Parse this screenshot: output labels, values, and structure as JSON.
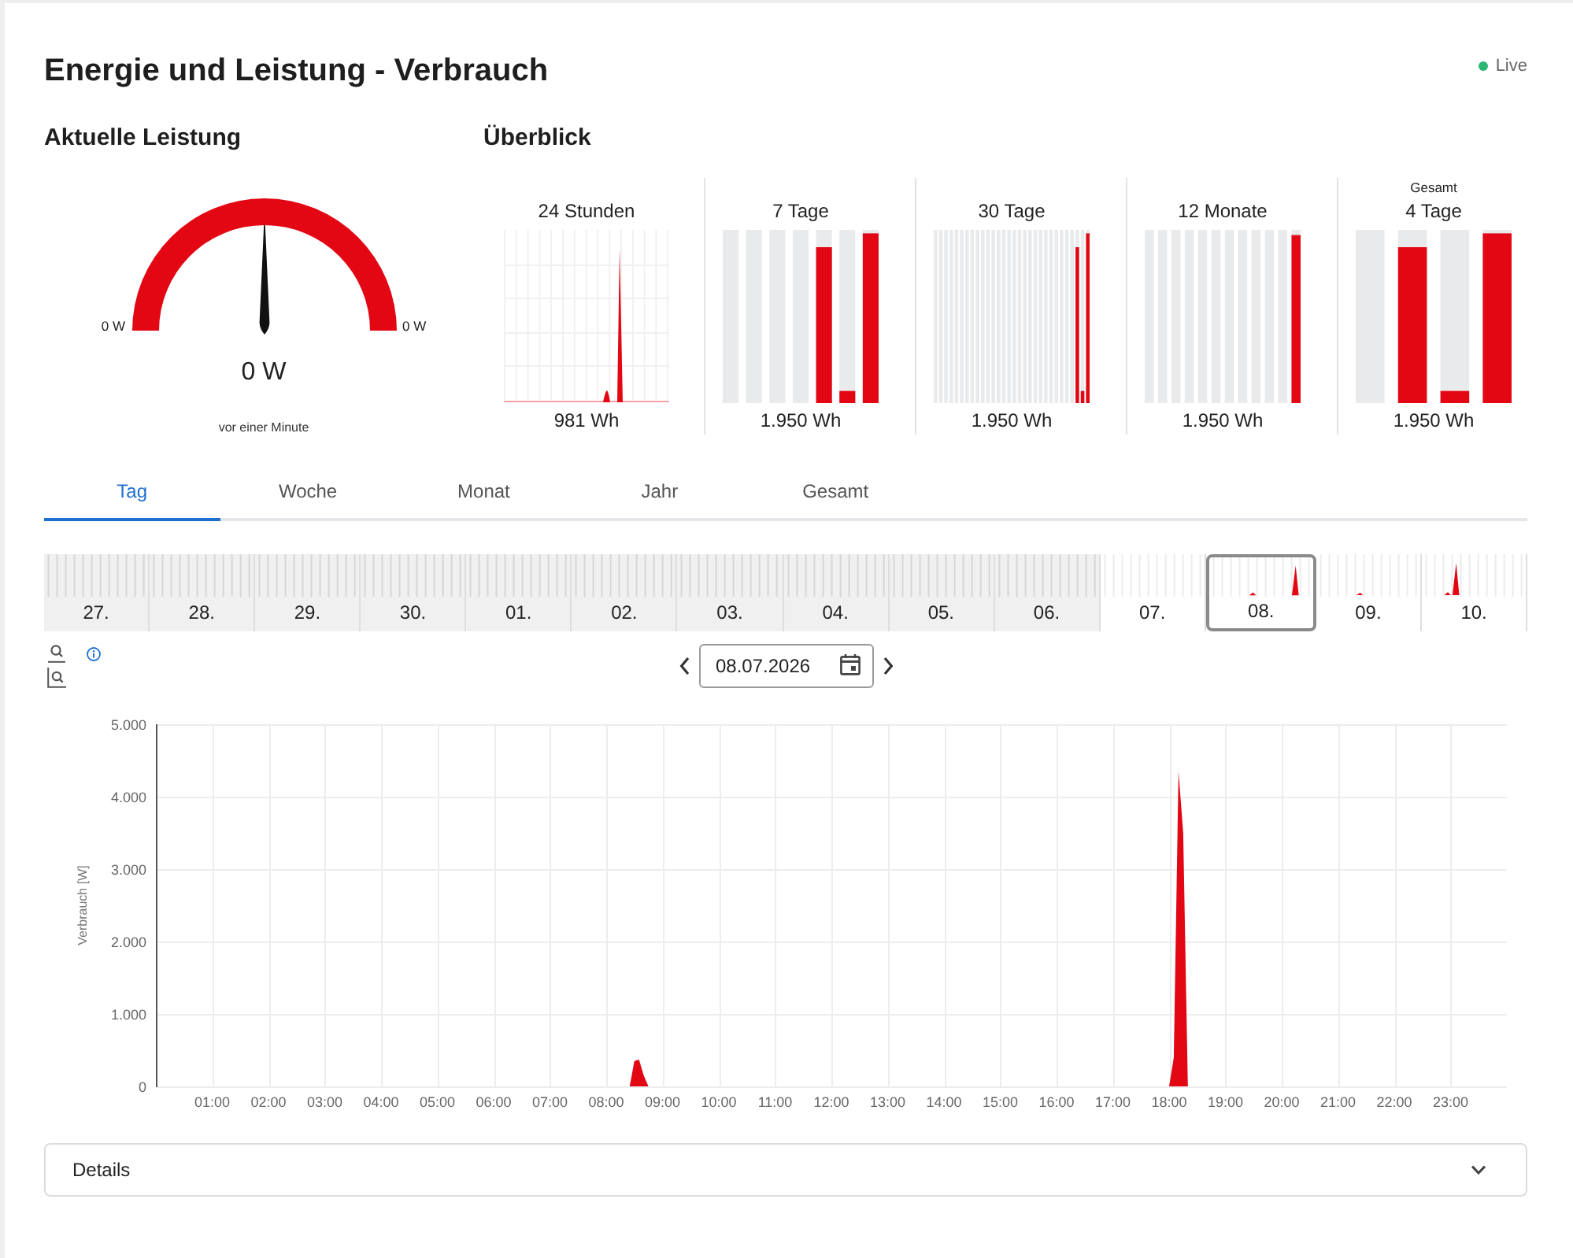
{
  "header": {
    "title": "Energie und Leistung - Verbrauch",
    "live": {
      "label": "Live",
      "on": true
    }
  },
  "current_power": {
    "heading": "Aktuelle Leistung",
    "gauge": {
      "min_label": "0 W",
      "max_label": "0 W",
      "value": "0 W",
      "level": 0.5
    },
    "updated": "vor einer Minute"
  },
  "overview": {
    "heading": "Überblick",
    "items": [
      {
        "kind": "area",
        "title": "24 Stunden",
        "value": "981 Wh"
      },
      {
        "kind": "bars",
        "title": "7 Tage",
        "value": "1.950 Wh"
      },
      {
        "kind": "bars",
        "title": "30 Tage",
        "value": "1.950 Wh"
      },
      {
        "kind": "bars",
        "title": "12 Monate",
        "value": "1.950 Wh"
      },
      {
        "kind": "bars",
        "caption": "Gesamt",
        "title": "4 Tage",
        "value": "1.950 Wh"
      }
    ]
  },
  "tabs": [
    {
      "label": "Tag",
      "selected": true
    },
    {
      "label": "Woche",
      "selected": false
    },
    {
      "label": "Monat",
      "selected": false
    },
    {
      "label": "Jahr",
      "selected": false
    },
    {
      "label": "Gesamt",
      "selected": false
    }
  ],
  "day_strip": [
    {
      "label": "27.",
      "disabled": true,
      "selected": false
    },
    {
      "label": "28.",
      "disabled": true,
      "selected": false
    },
    {
      "label": "29.",
      "disabled": true,
      "selected": false
    },
    {
      "label": "30.",
      "disabled": true,
      "selected": false
    },
    {
      "label": "01.",
      "disabled": true,
      "selected": false
    },
    {
      "label": "02.",
      "disabled": true,
      "selected": false
    },
    {
      "label": "03.",
      "disabled": true,
      "selected": false
    },
    {
      "label": "04.",
      "disabled": true,
      "selected": false
    },
    {
      "label": "05.",
      "disabled": true,
      "selected": false
    },
    {
      "label": "06.",
      "disabled": true,
      "selected": false
    },
    {
      "label": "07.",
      "disabled": false,
      "selected": false
    },
    {
      "label": "08.",
      "disabled": false,
      "selected": true
    },
    {
      "label": "09.",
      "disabled": false,
      "selected": false
    },
    {
      "label": "10.",
      "disabled": false,
      "selected": false
    }
  ],
  "date_nav": {
    "value": "08.07.2026"
  },
  "chart": {
    "chart_data": {
      "type": "area",
      "ylabel": "Verbrauch [W]",
      "grid": true,
      "x": [
        8.417,
        8.5,
        8.583,
        8.667,
        8.75,
        18.0,
        18.083,
        18.167,
        18.25,
        18.333
      ],
      "xlim": [
        0,
        24
      ],
      "ylim": [
        0,
        5000
      ],
      "xticks": [
        {
          "value": 1,
          "label": "01:00"
        },
        {
          "value": 2,
          "label": "02:00"
        },
        {
          "value": 3,
          "label": "03:00"
        },
        {
          "value": 4,
          "label": "04:00"
        },
        {
          "value": 5,
          "label": "05:00"
        },
        {
          "value": 6,
          "label": "06:00"
        },
        {
          "value": 7,
          "label": "07:00"
        },
        {
          "value": 8,
          "label": "08:00"
        },
        {
          "value": 9,
          "label": "09:00"
        },
        {
          "value": 10,
          "label": "10:00"
        },
        {
          "value": 11,
          "label": "11:00"
        },
        {
          "value": 12,
          "label": "12:00"
        },
        {
          "value": 13,
          "label": "13:00"
        },
        {
          "value": 14,
          "label": "14:00"
        },
        {
          "value": 15,
          "label": "15:00"
        },
        {
          "value": 16,
          "label": "16:00"
        },
        {
          "value": 17,
          "label": "17:00"
        },
        {
          "value": 18,
          "label": "18:00"
        },
        {
          "value": 19,
          "label": "19:00"
        },
        {
          "value": 20,
          "label": "20:00"
        },
        {
          "value": 21,
          "label": "21:00"
        },
        {
          "value": 22,
          "label": "22:00"
        },
        {
          "value": 23,
          "label": "23:00"
        }
      ],
      "yticks": [
        {
          "value": 0,
          "label": "0"
        },
        {
          "value": 1000,
          "label": "1.000"
        },
        {
          "value": 2000,
          "label": "2.000"
        },
        {
          "value": 3000,
          "label": "3.000"
        },
        {
          "value": 4000,
          "label": "4.000"
        },
        {
          "value": 5000,
          "label": "5.000"
        }
      ],
      "series": [
        {
          "color": "#e30613",
          "values": [
            0,
            350,
            370,
            150,
            0,
            0,
            400,
            4350,
            3500,
            0
          ]
        }
      ]
    }
  },
  "details": {
    "label": "Details",
    "expanded": false
  }
}
